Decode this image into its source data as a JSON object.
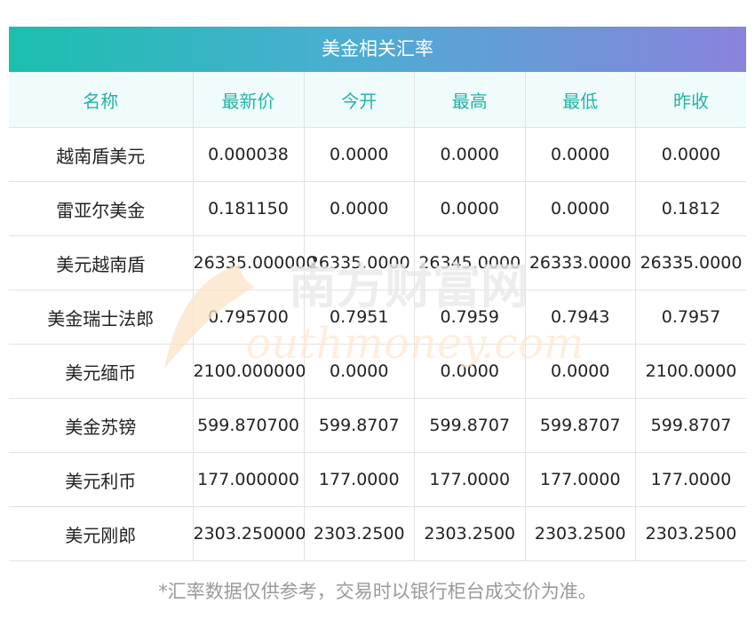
{
  "panel": {
    "title": "美金相关汇率",
    "columns": [
      "名称",
      "最新价",
      "今开",
      "最高",
      "最低",
      "昨收"
    ],
    "rows": [
      [
        "越南盾美元",
        "0.000038",
        "0.0000",
        "0.0000",
        "0.0000",
        "0.0000"
      ],
      [
        "雷亚尔美金",
        "0.181150",
        "0.0000",
        "0.0000",
        "0.0000",
        "0.1812"
      ],
      [
        "美元越南盾",
        "26335.000000",
        "26335.0000",
        "26345.0000",
        "26333.0000",
        "26335.0000"
      ],
      [
        "美金瑞士法郎",
        "0.795700",
        "0.7951",
        "0.7959",
        "0.7943",
        "0.7957"
      ],
      [
        "美元缅币",
        "2100.000000",
        "0.0000",
        "0.0000",
        "0.0000",
        "2100.0000"
      ],
      [
        "美金苏镑",
        "599.870700",
        "599.8707",
        "599.8707",
        "599.8707",
        "599.8707"
      ],
      [
        "美元利币",
        "177.000000",
        "177.0000",
        "177.0000",
        "177.0000",
        "177.0000"
      ],
      [
        "美元刚郎",
        "2303.250000",
        "2303.2500",
        "2303.2500",
        "2303.2500",
        "2303.2500"
      ]
    ]
  },
  "watermark": {
    "cn": "南方财富网",
    "en": "outhmoney.com"
  },
  "footnote": "*汇率数据仅供参考，交易时以银行柜台成交价为准。",
  "colors": {
    "header_text": "#24b3a7",
    "header_bg": "#effcfb",
    "title_gradient_start": "#1bbfae",
    "title_gradient_end": "#8a83dc"
  }
}
